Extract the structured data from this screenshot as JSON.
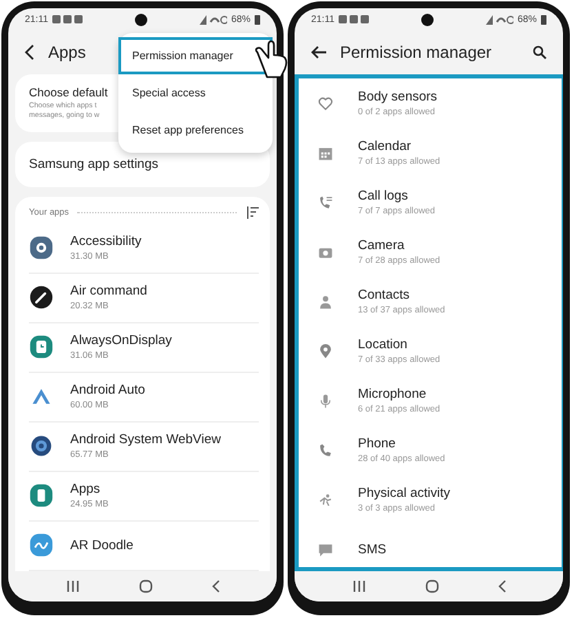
{
  "left_screen": {
    "status_bar": {
      "time": "21:11",
      "battery": "68%"
    },
    "title": "Apps",
    "menu": [
      {
        "label": "Permission manager",
        "selected": true
      },
      {
        "label": "Special access",
        "selected": false
      },
      {
        "label": "Reset app preferences",
        "selected": false
      }
    ],
    "default_card": {
      "title": "Choose default",
      "description": "Choose which apps t\nmessages, going to w"
    },
    "settings_card": {
      "title": "Samsung app settings"
    },
    "section": "Your apps",
    "apps": [
      {
        "name": "Accessibility",
        "size": "31.30 MB"
      },
      {
        "name": "Air command",
        "size": "20.32 MB"
      },
      {
        "name": "AlwaysOnDisplay",
        "size": "31.06 MB"
      },
      {
        "name": "Android Auto",
        "size": "60.00 MB"
      },
      {
        "name": "Android System WebView",
        "size": "65.77 MB"
      },
      {
        "name": "Apps",
        "size": "24.95 MB"
      },
      {
        "name": "AR Doodle"
      }
    ]
  },
  "right_screen": {
    "status_bar": {
      "time": "21:11",
      "battery": "68%"
    },
    "title": "Permission manager",
    "highlighted": true,
    "permissions": [
      {
        "name": "Body sensors",
        "allowed": "0 of 2 apps allowed"
      },
      {
        "name": "Calendar",
        "allowed": "7 of 13 apps allowed"
      },
      {
        "name": "Call logs",
        "allowed": "7 of 7 apps allowed"
      },
      {
        "name": "Camera",
        "allowed": "7 of 28 apps allowed"
      },
      {
        "name": "Contacts",
        "allowed": "13 of 37 apps allowed"
      },
      {
        "name": "Location",
        "allowed": "7 of 33 apps allowed"
      },
      {
        "name": "Microphone",
        "allowed": "6 of 21 apps allowed"
      },
      {
        "name": "Phone",
        "allowed": "28 of 40 apps allowed"
      },
      {
        "name": "Physical activity",
        "allowed": "3 of 3 apps allowed"
      },
      {
        "name": "SMS"
      }
    ]
  }
}
